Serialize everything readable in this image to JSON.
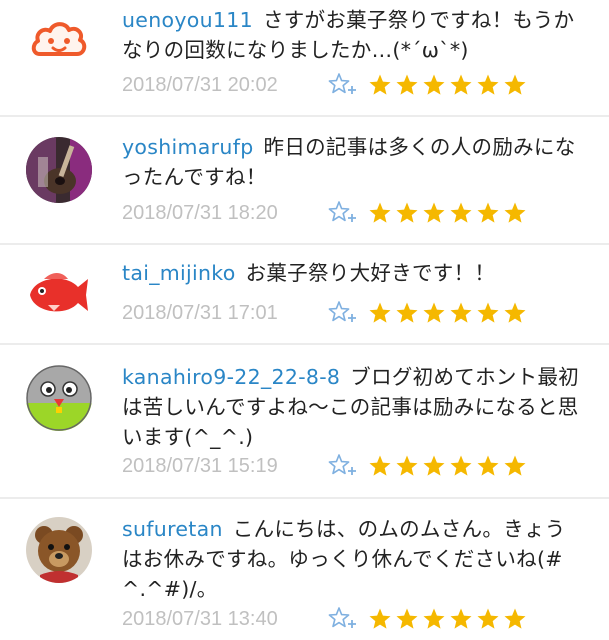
{
  "colors": {
    "username": "#2a86c6",
    "timestamp": "#c0c0c0",
    "star": "#f5b800",
    "fav": "#7fb0e0"
  },
  "comments": [
    {
      "user": "uenoyou111",
      "text": "さすがお菓子祭りですね！もうかなりの回数になりましたか…(*´ω`*)",
      "time": "2018/07/31 20:02",
      "rating": 6,
      "avatar": "cloud-face-avatar"
    },
    {
      "user": "yoshimarufp",
      "text": "昨日の記事は多くの人の励みになったんですね！",
      "time": "2018/07/31 18:20",
      "rating": 6,
      "avatar": "guitar-photo-avatar"
    },
    {
      "user": "tai_mijinko",
      "text": "お菓子祭り大好きです！！",
      "time": "2018/07/31 17:01",
      "rating": 6,
      "avatar": "red-fish-avatar"
    },
    {
      "user": "kanahiro9-22_22-8-8",
      "text": "ブログ初めてホント最初は苦しいんですよね〜この記事は励みになると思います(^_^.)",
      "time": "2018/07/31 15:19",
      "rating": 6,
      "avatar": "round-character-avatar"
    },
    {
      "user": "sufuretan",
      "text": "こんにちは、のムのムさん。きょうはお休みですね。ゆっくり休んでくださいね(#^.^#)/。",
      "time": "2018/07/31 13:40",
      "rating": 6,
      "avatar": "teddy-bear-avatar"
    }
  ]
}
